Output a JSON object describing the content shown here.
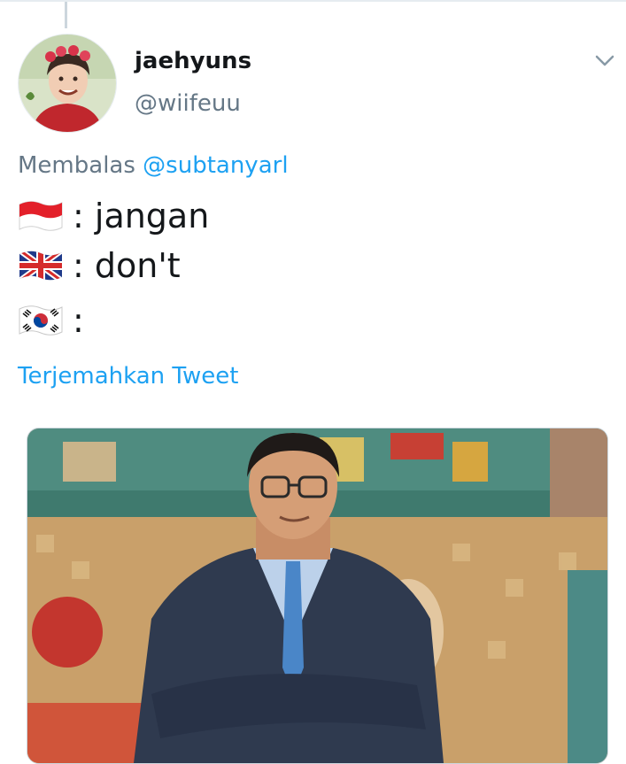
{
  "tweet": {
    "display_name": "jaehyuns",
    "handle": "@wiifeuu",
    "reply_prefix": "Membalas",
    "reply_mention": "@subtanyarl",
    "lines": [
      {
        "flag_icon": "indonesia-flag-icon",
        "text": ": jangan"
      },
      {
        "flag_icon": "uk-flag-icon",
        "text": ": don't"
      },
      {
        "flag_icon": "south-korea-flag-icon",
        "text": ":"
      }
    ],
    "translate_label": "Terjemahkan Tweet",
    "menu_icon": "chevron-down-icon"
  },
  "colors": {
    "text_primary": "#14171a",
    "text_secondary": "#657786",
    "link": "#1da1f2",
    "border": "#e6ecf0"
  }
}
